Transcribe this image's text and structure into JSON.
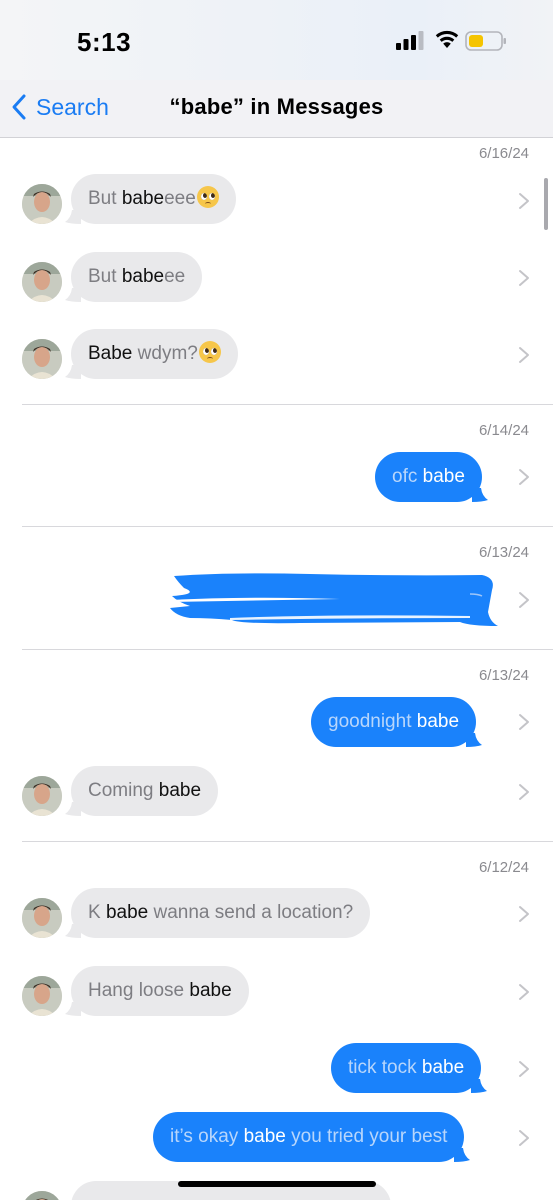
{
  "status_bar": {
    "time": "5:13",
    "signal_icon": "cellular-signal-icon",
    "wifi_icon": "wifi-icon",
    "battery_icon": "battery-low-icon",
    "battery_color": "#f5c400"
  },
  "nav": {
    "back_label": "Search",
    "title": "“babe” in Messages"
  },
  "colors": {
    "accent": "#1a7cf3",
    "outgoing_bubble": "#1a82fb",
    "incoming_bubble": "#e9e9eb"
  },
  "groups": [
    {
      "date": "6/16/24"
    },
    {
      "date": "6/14/24"
    },
    {
      "date": "6/13/24"
    },
    {
      "date": "6/13/24"
    },
    {
      "date": "6/12/24"
    }
  ],
  "messages": [
    {
      "direction": "in",
      "pre": "But ",
      "hl": "babe",
      "post": "eee",
      "emoji": "pleading-face-emoji"
    },
    {
      "direction": "in",
      "pre": "But ",
      "hl": "babe",
      "post": "ee"
    },
    {
      "direction": "in",
      "pre": "",
      "hl": "Babe",
      "post": " wdym?",
      "emoji": "pleading-face-emoji"
    },
    {
      "direction": "out",
      "pre": "ofc ",
      "hl": "babe",
      "post": ""
    },
    {
      "direction": "out",
      "redacted": true
    },
    {
      "direction": "out",
      "pre": "goodnight ",
      "hl": "babe",
      "post": ""
    },
    {
      "direction": "in",
      "pre": "Coming ",
      "hl": "babe",
      "post": ""
    },
    {
      "direction": "in",
      "pre": "K ",
      "hl": "babe",
      "post": " wanna send a location?"
    },
    {
      "direction": "in",
      "pre": "Hang loose ",
      "hl": "babe",
      "post": ""
    },
    {
      "direction": "out",
      "pre": "tick tock ",
      "hl": "babe",
      "post": ""
    },
    {
      "direction": "out",
      "pre": "it’s okay ",
      "hl": "babe",
      "post": " you tried your best"
    }
  ]
}
